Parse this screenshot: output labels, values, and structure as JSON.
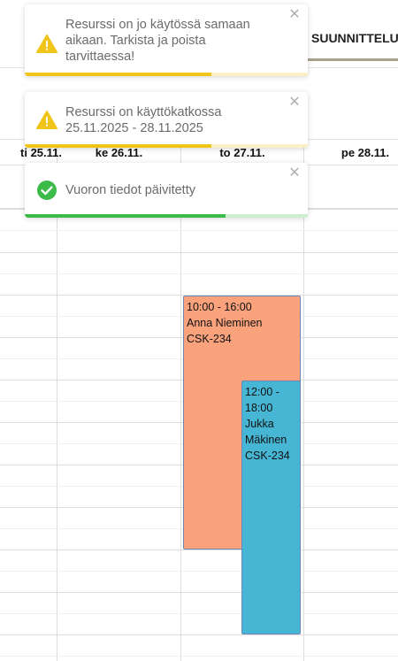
{
  "header": {
    "tab_label": "SUUNNITTELU"
  },
  "calendar": {
    "days": [
      {
        "label": "ti 25.11."
      },
      {
        "label": "ke 26.11."
      },
      {
        "label": "to 27.11."
      },
      {
        "label": "pe 28.11."
      }
    ],
    "events": [
      {
        "time": "10:00 - 16:00",
        "person": "Anna Nieminen",
        "code": "CSK-234",
        "color": "#f9a27c"
      },
      {
        "time_start": "12:00 -",
        "time_end": "18:00",
        "first_name": "Jukka",
        "last_name": "Mäkinen",
        "code": "CSK-234",
        "color": "#47b6d4"
      }
    ]
  },
  "toasts": [
    {
      "type": "warning",
      "icon": "warning-icon",
      "lines": [
        "Resurssi on jo käytössä samaan",
        "aikaan. Tarkista ja poista",
        "tarvittaessa!"
      ],
      "progress_remaining": 0.66,
      "color": "#f0c419"
    },
    {
      "type": "warning",
      "icon": "warning-icon",
      "lines": [
        "Resurssi on käyttökatkossa",
        "25.11.2025 - 28.11.2025"
      ],
      "progress_remaining": 0.66,
      "color": "#f0c419"
    },
    {
      "type": "success",
      "icon": "check-circle-icon",
      "lines": [
        "Vuoron tiedot päivitetty"
      ],
      "progress_remaining": 0.71,
      "color": "#3dbb49"
    }
  ]
}
